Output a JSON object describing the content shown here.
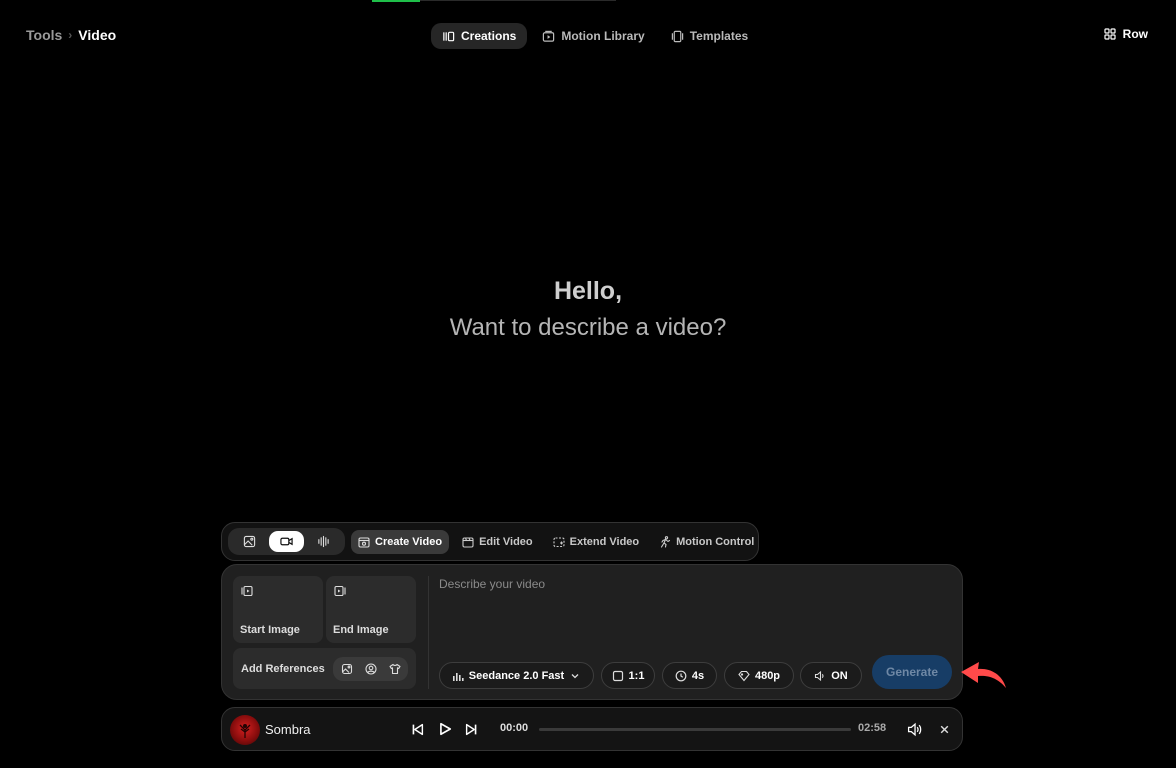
{
  "breadcrumb": {
    "parent": "Tools",
    "separator": "›",
    "current": "Video"
  },
  "tabs": [
    {
      "label": "Creations",
      "icon": "creations-icon",
      "active": true
    },
    {
      "label": "Motion Library",
      "icon": "motion-library-icon",
      "active": false
    },
    {
      "label": "Templates",
      "icon": "templates-icon",
      "active": false
    }
  ],
  "layout_toggle": {
    "label": "Row",
    "icon": "grid-icon"
  },
  "greeting": {
    "title": "Hello,",
    "subtitle": "Want to describe a video?"
  },
  "media_types": [
    {
      "name": "image",
      "active": false
    },
    {
      "name": "video",
      "active": true
    },
    {
      "name": "audio",
      "active": false
    }
  ],
  "modes": [
    {
      "label": "Create Video",
      "active": true
    },
    {
      "label": "Edit Video",
      "active": false
    },
    {
      "label": "Extend Video",
      "active": false
    },
    {
      "label": "Motion Control",
      "active": false
    }
  ],
  "composer": {
    "start_image_label": "Start Image",
    "end_image_label": "End Image",
    "references_label": "Add References",
    "prompt_placeholder": "Describe your video",
    "prompt_value": "",
    "model": "Seedance 2.0 Fast",
    "aspect_ratio": "1:1",
    "duration": "4s",
    "resolution": "480p",
    "sound": "ON",
    "generate_label": "Generate"
  },
  "player": {
    "track": "Sombra",
    "current_time": "00:00",
    "total_time": "02:58",
    "progress": 0
  },
  "colors": {
    "accent": "#1fbf4a",
    "generate_bg": "#173d66",
    "arrow": "#ff4a4a"
  }
}
